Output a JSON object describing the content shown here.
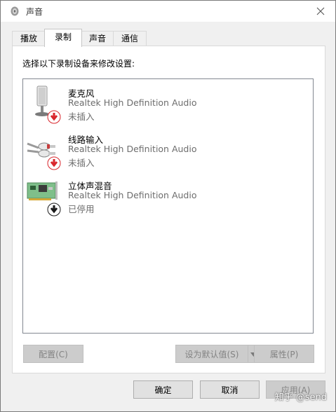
{
  "window": {
    "title": "声音"
  },
  "tabs": [
    {
      "label": "播放"
    },
    {
      "label": "录制",
      "active": true
    },
    {
      "label": "声音"
    },
    {
      "label": "通信"
    }
  ],
  "instruction": "选择以下录制设备来修改设置:",
  "devices": [
    {
      "name": "麦克风",
      "driver": "Realtek High Definition Audio",
      "status": "未插入",
      "icon": "microphone-icon",
      "badge": "red-down-arrow"
    },
    {
      "name": "线路输入",
      "driver": "Realtek High Definition Audio",
      "status": "未插入",
      "icon": "line-in-cable-icon",
      "badge": "red-down-arrow"
    },
    {
      "name": "立体声混音",
      "driver": "Realtek High Definition Audio",
      "status": "已停用",
      "icon": "sound-card-icon",
      "badge": "black-down-arrow"
    }
  ],
  "buttons": {
    "configure": "配置(C)",
    "set_default": "设为默认值(S)",
    "properties": "属性(P)",
    "ok": "确定",
    "cancel": "取消",
    "apply": "应用(A)"
  },
  "watermark": "知乎 @send",
  "colors": {
    "badge_red": "#d9262c",
    "badge_black": "#1a1a1a",
    "status_gray": "#6d6d6d"
  }
}
